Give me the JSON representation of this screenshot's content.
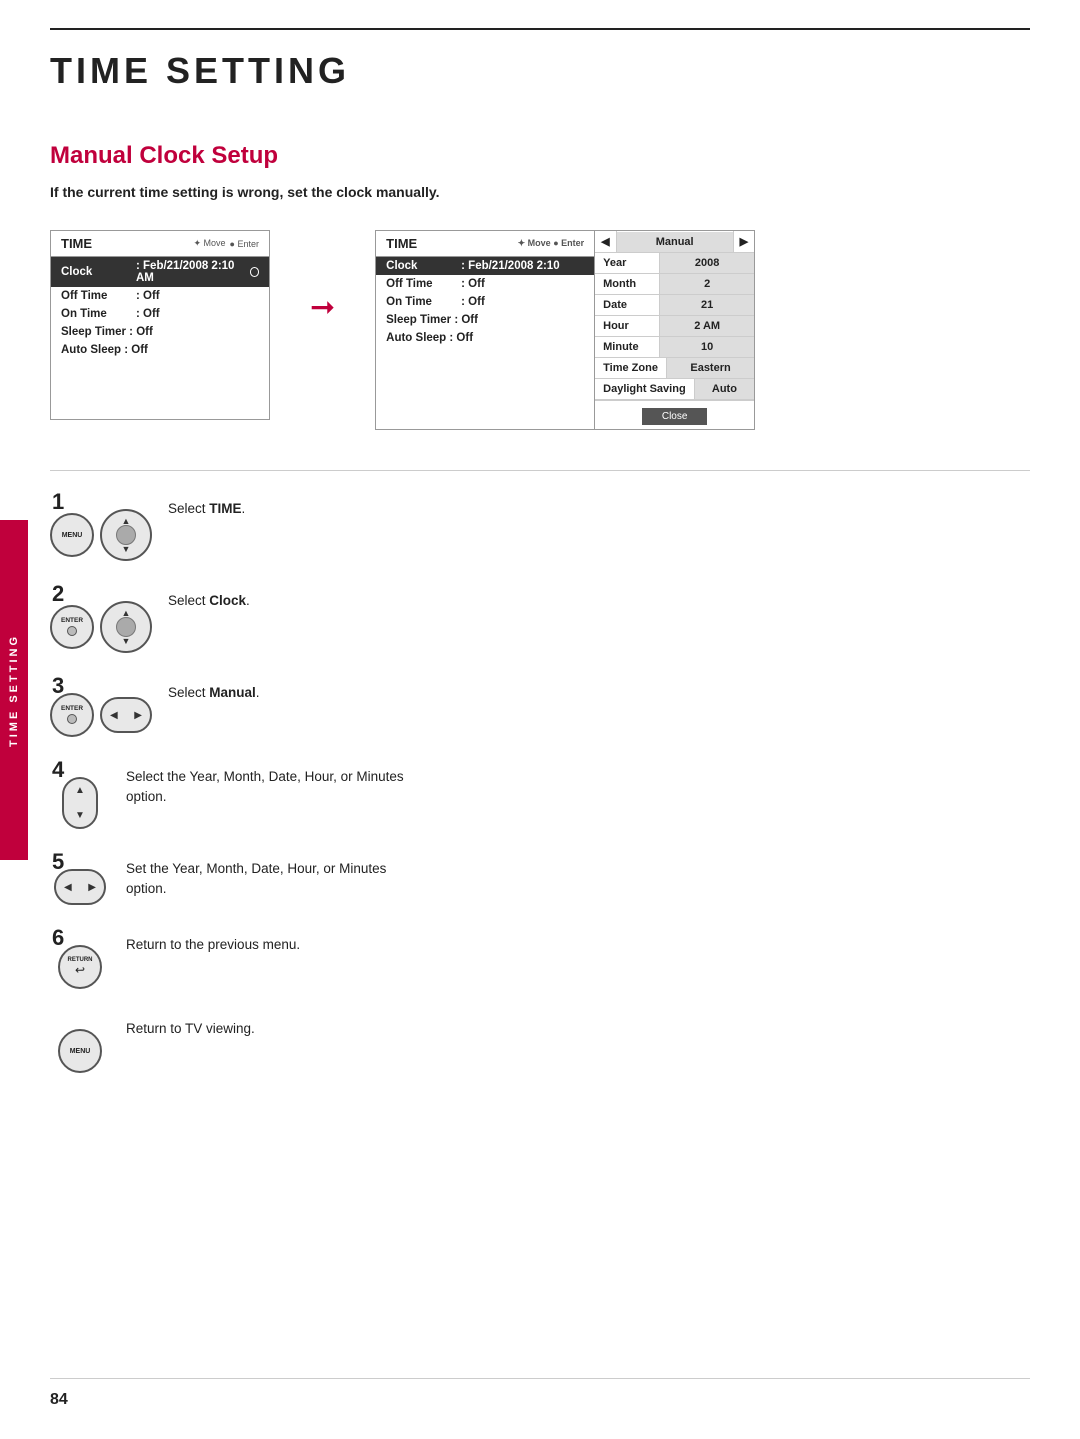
{
  "page": {
    "title": "TIME SETTING",
    "page_number": "84"
  },
  "section": {
    "title": "Manual Clock Setup",
    "description": "If the current time setting is wrong, set the clock manually."
  },
  "side_label": "TIME SETTING",
  "menu_left": {
    "title": "TIME",
    "controls": "Move  Enter",
    "rows": [
      {
        "label": "Clock",
        "value": ": Feb/21/2008 2:10 AM",
        "highlight": true
      },
      {
        "label": "Off Time",
        "value": ": Off",
        "highlight": false
      },
      {
        "label": "On Time",
        "value": ": Off",
        "highlight": false
      },
      {
        "label": "Sleep Timer",
        "value": ": Off",
        "highlight": false
      },
      {
        "label": "Auto Sleep",
        "value": ": Off",
        "highlight": false
      }
    ]
  },
  "menu_right": {
    "title": "TIME",
    "controls": "Move  Enter",
    "rows": [
      {
        "label": "Clock",
        "value": ": Feb/21/2008 2:10",
        "highlight": true
      },
      {
        "label": "Off Time",
        "value": ": Off",
        "highlight": false
      },
      {
        "label": "On Time",
        "value": ": Off",
        "highlight": false
      },
      {
        "label": "Sleep Timer",
        "value": ": Off",
        "highlight": false
      },
      {
        "label": "Auto Sleep",
        "value": ": Off",
        "highlight": false
      }
    ],
    "options": [
      {
        "label": "Year",
        "value": "2008"
      },
      {
        "label": "Month",
        "value": "2"
      },
      {
        "label": "Date",
        "value": "21"
      },
      {
        "label": "Hour",
        "value": "2 AM"
      },
      {
        "label": "Minute",
        "value": "10"
      },
      {
        "label": "Time Zone",
        "value": "Eastern"
      },
      {
        "label": "Daylight Saving",
        "value": "Auto"
      }
    ],
    "nav_label": "Manual",
    "close_btn": "Close"
  },
  "steps": [
    {
      "number": "1",
      "buttons": [
        "menu",
        "nav-ud"
      ],
      "text": "Select <strong>TIME</strong>.",
      "text_plain": "Select TIME."
    },
    {
      "number": "2",
      "buttons": [
        "enter",
        "nav-ud"
      ],
      "text": "Select <strong>Clock</strong>.",
      "text_plain": "Select Clock."
    },
    {
      "number": "3",
      "buttons": [
        "enter",
        "nav-lr"
      ],
      "text": "Select <strong>Manual</strong>.",
      "text_plain": "Select Manual."
    },
    {
      "number": "4",
      "buttons": [
        "nav-ud"
      ],
      "text": "Select the Year, Month, Date, Hour, or Minutes option.",
      "text_plain": "Select the Year, Month, Date, Hour, or Minutes option."
    },
    {
      "number": "5",
      "buttons": [
        "nav-lr"
      ],
      "text": "Set the Year, Month, Date, Hour, or Minutes option.",
      "text_plain": "Set the Year, Month, Date, Hour, or Minutes option."
    },
    {
      "number": "6",
      "buttons": [
        "return"
      ],
      "text": "Return to the previous menu.",
      "text_plain": "Return to the previous menu."
    },
    {
      "number": "",
      "buttons": [
        "menu"
      ],
      "text": "Return to TV viewing.",
      "text_plain": "Return to TV viewing."
    }
  ]
}
